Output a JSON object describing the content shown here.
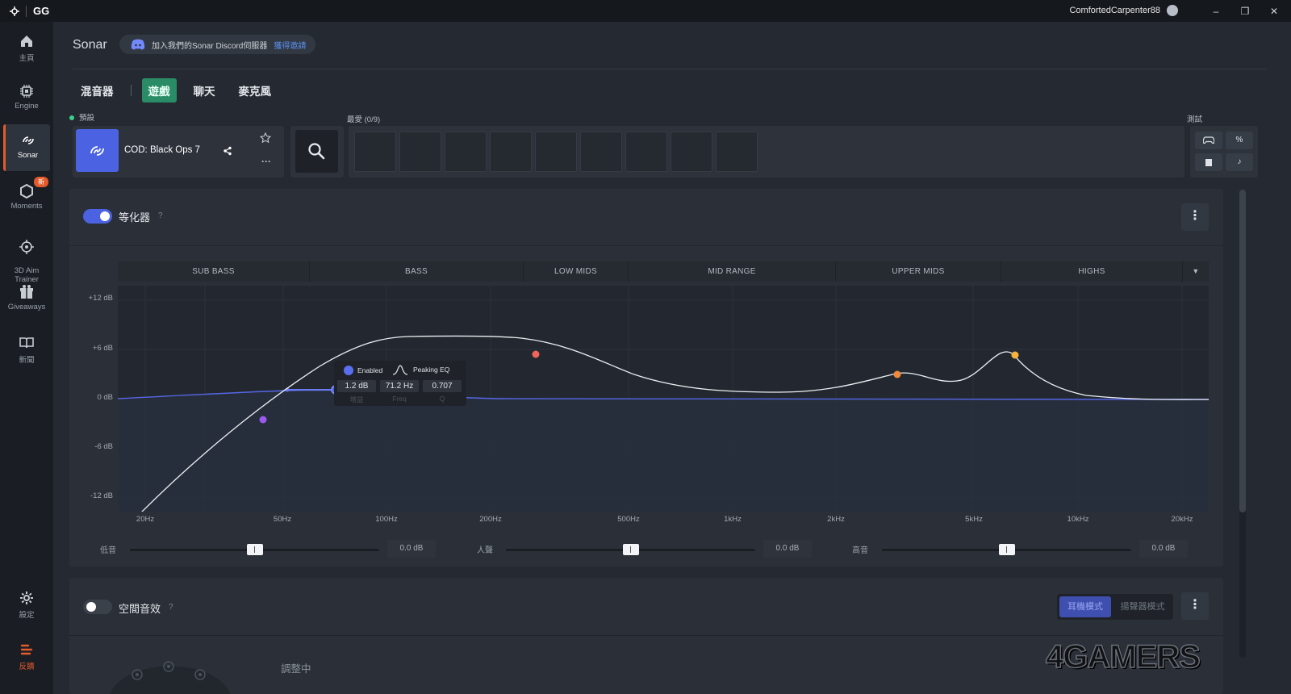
{
  "titlebar": {
    "app_name": "GG",
    "username": "ComfortedCarpenter88",
    "btn_min": "–",
    "btn_max": "❐",
    "btn_close": "✕"
  },
  "sidebar": {
    "items": [
      {
        "label": "主頁",
        "icon": "home-icon"
      },
      {
        "label": "Engine",
        "icon": "chip-icon"
      },
      {
        "label": "Sonar",
        "icon": "sonar-icon",
        "active": true
      },
      {
        "label": "Moments",
        "icon": "hexagon-icon",
        "badge": "新"
      },
      {
        "label": "3D Aim\nTrainer",
        "icon": "aim-icon"
      },
      {
        "label": "Giveaways",
        "icon": "gift-icon"
      },
      {
        "label": "新聞",
        "icon": "book-icon"
      }
    ],
    "settings_label": "設定",
    "feedback_label": "反饋"
  },
  "header": {
    "title": "Sonar",
    "discord_text": "加入我們的Sonar Discord伺服器",
    "discord_link": "獲得邀請"
  },
  "tabs": [
    {
      "label": "混音器"
    },
    {
      "label": "遊戲",
      "active": true
    },
    {
      "label": "聊天"
    },
    {
      "label": "麥克風"
    }
  ],
  "preset": {
    "section_label": "預設",
    "name": "COD: Black Ops 7"
  },
  "favorites": {
    "label": "最愛 (0/9)",
    "slots": 9
  },
  "test": {
    "label": "測試"
  },
  "equalizer": {
    "title": "等化器",
    "help": "?",
    "enabled": true,
    "bands": [
      "SUB BASS",
      "BASS",
      "LOW MIDS",
      "MID RANGE",
      "UPPER MIDS",
      "HIGHS"
    ],
    "y_ticks": [
      "+12 dB",
      "+6 dB",
      "0 dB",
      "-6 dB",
      "-12 dB"
    ],
    "x_ticks": [
      "20Hz",
      "50Hz",
      "100Hz",
      "200Hz",
      "500Hz",
      "1kHz",
      "2kHz",
      "5kHz",
      "10kHz",
      "20kHz"
    ],
    "tooltip": {
      "enabled_label": "Enabled",
      "type_label": "Peaking EQ",
      "gain": "1.2 dB",
      "gain_label": "增益",
      "freq": "71.2 Hz",
      "freq_label": "Freq",
      "q": "0.707",
      "q_label": "Q"
    },
    "sliders": [
      {
        "label": "低音",
        "value": "0.0 dB",
        "position": 0.5
      },
      {
        "label": "人聲",
        "value": "0.0 dB",
        "position": 0.5
      },
      {
        "label": "高音",
        "value": "0.0 dB",
        "position": 0.5
      }
    ],
    "colors": {
      "accent": "#4b63e3",
      "point_purple": "#9b59f0",
      "point_red": "#f0645a",
      "point_orange": "#f08a3a",
      "point_yellow": "#f6b23a"
    }
  },
  "spatial": {
    "title": "空間音效",
    "help": "?",
    "enabled": false,
    "mode_headphone": "耳機模式",
    "mode_speaker": "揚聲器模式",
    "status": "調整中"
  },
  "watermark": "4GAMERS"
}
